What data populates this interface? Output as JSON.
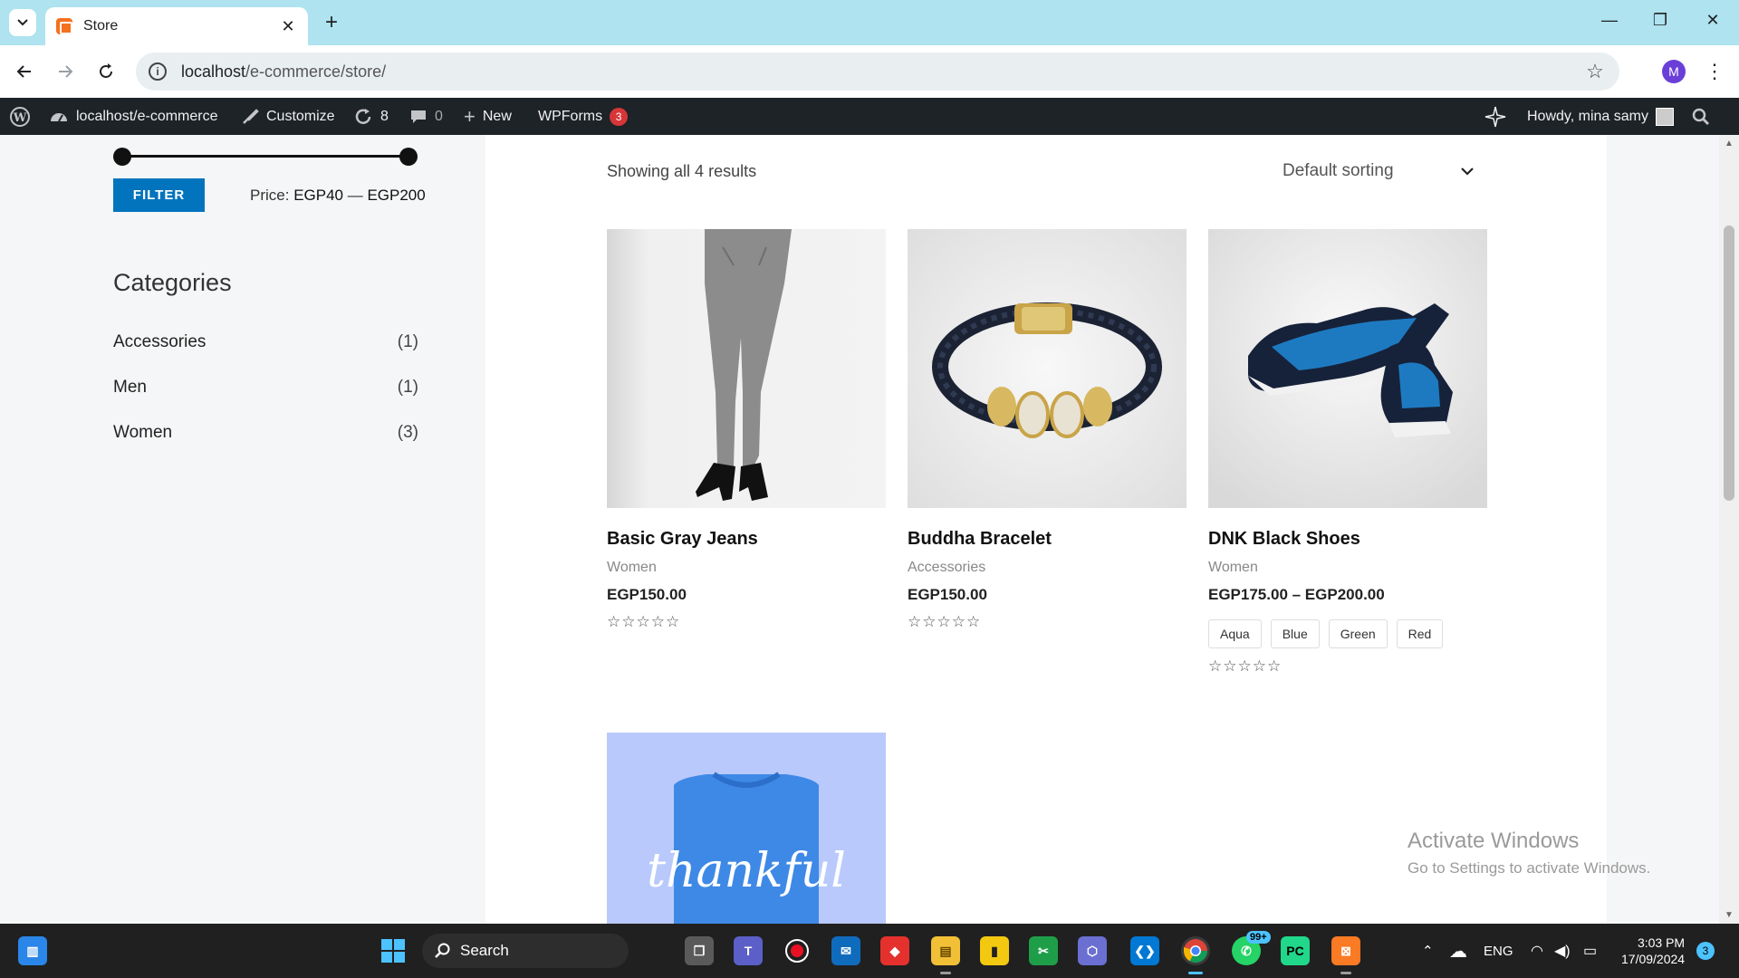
{
  "browser": {
    "tab_title": "Store",
    "url_host": "localhost",
    "url_path": "/e-commerce/store/",
    "profile_initial": "M"
  },
  "adminbar": {
    "site_name": "localhost/e-commerce",
    "customize": "Customize",
    "updates_count": "8",
    "comments_count": "0",
    "new_label": "New",
    "wpforms_label": "WPForms",
    "wpforms_count": "3",
    "howdy": "Howdy, mina samy"
  },
  "sidebar": {
    "filter_button": "FILTER",
    "price_prefix": "Price: ",
    "price_min": "EGP40",
    "price_sep": " — ",
    "price_max": "EGP200",
    "categories_heading": "Categories",
    "categories": [
      {
        "name": "Accessories",
        "count": "(1)"
      },
      {
        "name": "Men",
        "count": "(1)"
      },
      {
        "name": "Women",
        "count": "(3)"
      }
    ]
  },
  "shop": {
    "result_count": "Showing all 4 results",
    "sorting": "Default sorting",
    "products": [
      {
        "name": "Basic Gray Jeans",
        "category": "Women",
        "price": "EGP150.00",
        "rating": "☆☆☆☆☆"
      },
      {
        "name": "Buddha Bracelet",
        "category": "Accessories",
        "price": "EGP150.00",
        "rating": "☆☆☆☆☆"
      },
      {
        "name": "DNK Black Shoes",
        "category": "Women",
        "price": "EGP175.00 – EGP200.00",
        "rating": "☆☆☆☆☆",
        "swatches": [
          "Aqua",
          "Blue",
          "Green",
          "Red"
        ]
      },
      {
        "name": "",
        "category": "",
        "price": "",
        "image_text": "thankful"
      }
    ]
  },
  "watermark": {
    "line1": "Activate Windows",
    "line2": "Go to Settings to activate Windows."
  },
  "taskbar": {
    "search_label": "Search",
    "whatsapp_badge": "99+",
    "language": "ENG",
    "time": "3:03 PM",
    "date": "17/09/2024",
    "notifications": "3"
  },
  "colors": {
    "accent": "#0274be",
    "adminbar": "#1d2327",
    "tabbar": "#aee3ef",
    "badge": "#d63638"
  }
}
